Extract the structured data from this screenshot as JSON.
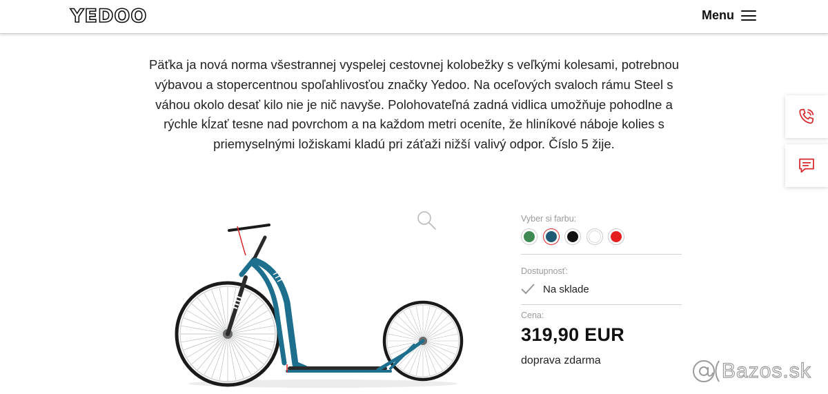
{
  "header": {
    "logo": "YEDOO",
    "menu_label": "Menu"
  },
  "description": "Päťka ja nová norma všestrannej vyspelej cestovnej kolobežky s veľkými kolesami, potrebnou výbavou a stopercentnou spoľahlivosťou značky Yedoo. Na oceľových svaloch rámu Steel s váhou okolo desať kilo nie je nič navyše. Polohovateľná zadná vidlica umožňuje pohodlne a rýchle kĺzať tesne nad povrchom a na každom metri oceníte, že hliníkové náboje kolies s priemyselnými ložiskami kladú pri záťaži nižší valivý odpor. Číslo 5 žije.",
  "side_buttons": [
    {
      "icon": "phone-icon"
    },
    {
      "icon": "chat-icon"
    }
  ],
  "product": {
    "image": "kick-scooter",
    "frame_color": "#1e6f8e",
    "color_label": "Vyber si farbu:",
    "colors": [
      {
        "color": "#3f8a52",
        "selected": false
      },
      {
        "color": "#1e5a74",
        "selected": true
      },
      {
        "color": "#111111",
        "selected": false
      },
      {
        "color": "#ffffff",
        "selected": false
      },
      {
        "color": "#e51f1f",
        "selected": false
      }
    ],
    "availability_label": "Dostupnosť:",
    "availability": "Na sklade",
    "price_label": "Cena:",
    "price": "319,90 EUR",
    "shipping": "doprava zdarma"
  },
  "watermark": {
    "text": "Bazos.sk"
  },
  "accent_color": "#d8262a"
}
